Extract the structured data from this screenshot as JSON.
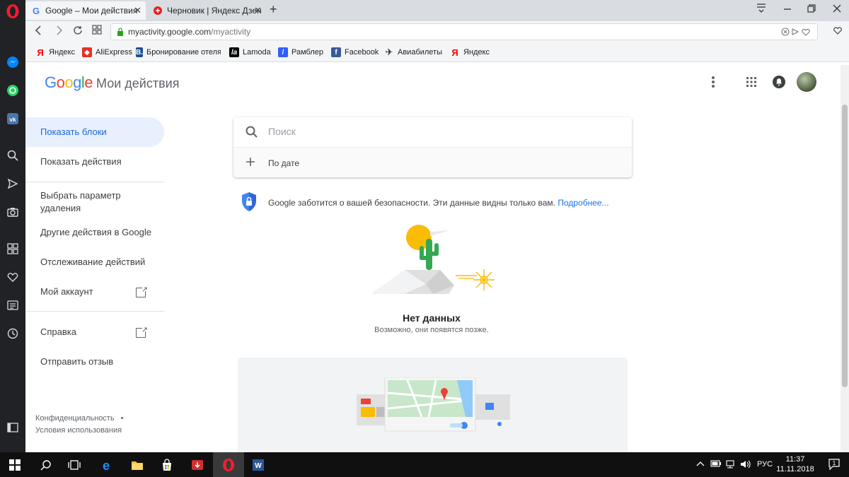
{
  "browser": {
    "tabs": [
      {
        "label": "Google – Мои действия",
        "active": true
      },
      {
        "label": "Черновик | Яндекс Дзен",
        "active": false
      }
    ],
    "new_tab_glyph": "+",
    "close_glyph": "✕",
    "url_host": "myactivity.google.com",
    "url_path": "/myactivity",
    "bookmarks": [
      {
        "label": "Яндекс",
        "icon": "yandex-icon"
      },
      {
        "label": "AliExpress",
        "icon": "aliexpress-icon"
      },
      {
        "label": "Бронирование отеля",
        "icon": "booking-icon"
      },
      {
        "label": "Lamoda",
        "icon": "lamoda-icon"
      },
      {
        "label": "Рамблер",
        "icon": "rambler-icon"
      },
      {
        "label": "Facebook",
        "icon": "facebook-icon"
      },
      {
        "label": "Авиабилеты",
        "icon": "plane-icon"
      },
      {
        "label": "Яндекс",
        "icon": "yandex-icon"
      }
    ]
  },
  "header": {
    "logo": "Google",
    "title": "Мои действия"
  },
  "sidebar": {
    "items": [
      {
        "label": "Показать блоки",
        "active": true
      },
      {
        "label": "Показать действия"
      },
      {
        "label": "Выбрать параметр удаления"
      },
      {
        "label": "Другие действия в Google"
      },
      {
        "label": "Отслеживание действий"
      },
      {
        "label": "Мой аккаунт"
      },
      {
        "label": "Справка"
      },
      {
        "label": "Отправить отзыв"
      }
    ],
    "footer": {
      "privacy": "Конфиденциальность",
      "dot": "•",
      "terms": "Условия использования"
    }
  },
  "search": {
    "placeholder": "Поиск",
    "filter_label": "По дате"
  },
  "privacy_notice": {
    "text": "Google заботится о вашей безопасности. Эти данные видны только вам.",
    "link": "Подробнее..."
  },
  "empty_state": {
    "title": "Нет данных",
    "subtitle": "Возможно, они появятся позже."
  },
  "taskbar": {
    "lang": "РУС",
    "time": "11:37",
    "date": "11.11.2018",
    "notifications": "1"
  },
  "colors": {
    "google_blue": "#4285f4",
    "google_red": "#ea4335",
    "google_yellow": "#fbbc05",
    "google_green": "#34a853",
    "active_nav_bg": "#e8f0fe",
    "active_nav_text": "#1967d2",
    "link": "#1a73e8"
  }
}
